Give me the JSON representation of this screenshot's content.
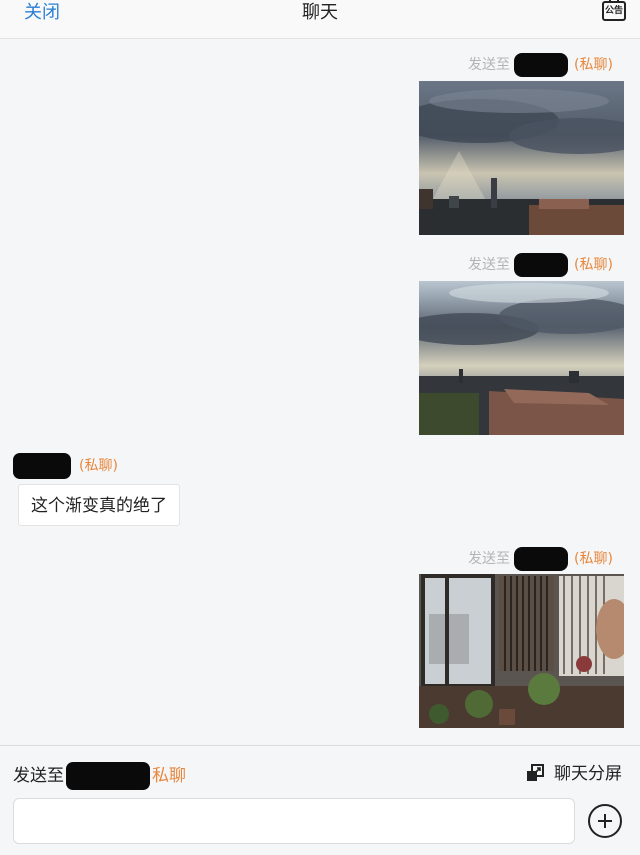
{
  "header": {
    "close_label": "关闭",
    "title": "聊天",
    "notice_label": "公告",
    "notice_icon": "notice-board-icon"
  },
  "messages": [
    {
      "sender_prefix": "发送至",
      "tag": "(私聊)",
      "image": "photo-sky-sunrays-city"
    },
    {
      "sender_prefix": "发送至",
      "tag": "(私聊)",
      "image": "photo-sky-clouds-rooftops"
    },
    {
      "tag": "(私聊)",
      "text": "这个渐变真的绝了"
    },
    {
      "sender_prefix": "发送至",
      "tag": "(私聊)",
      "image": "photo-balcony-window-plants"
    }
  ],
  "bottom": {
    "send_prefix": "发送至",
    "send_tag": "私聊",
    "split_label": "聊天分屏",
    "split_icon": "split-screen-icon",
    "input_placeholder": "",
    "plus_icon": "add-circle-icon"
  },
  "colors": {
    "accent_blue": "#2a7fd4",
    "tag_orange": "#e8873b",
    "meta_gray": "#b5b5b5"
  }
}
